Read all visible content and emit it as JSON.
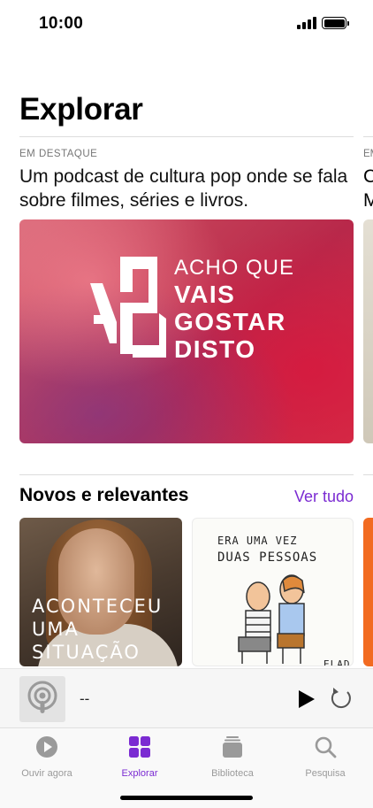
{
  "status": {
    "time": "10:00"
  },
  "page": {
    "title": "Explorar"
  },
  "featured": {
    "eyebrow": "EM DESTAQUE",
    "description": "Um podcast de cultura pop onde se fala sobre filmes, séries e livros.",
    "peek_eyebrow": "EM",
    "peek_desc_1": "C",
    "peek_desc_2": "M",
    "artwork": {
      "logo_text": "VG",
      "line1": "ACHO QUE",
      "line2": "VAIS",
      "line3": "GOSTAR",
      "line4": "DISTO"
    }
  },
  "new_section": {
    "title": "Novos e relevantes",
    "see_all": "Ver tudo",
    "tiles": [
      {
        "lines": [
          "ACONTECEU",
          "UMA",
          "SITUAÇÃO"
        ]
      },
      {
        "lines": [
          "ERA UMA VEZ",
          "DUAS PESSOAS"
        ],
        "corner": "ELAD"
      }
    ]
  },
  "mini_player": {
    "title": "--"
  },
  "tabs": [
    {
      "label": "Ouvir agora",
      "icon": "play-circle-icon",
      "active": false
    },
    {
      "label": "Explorar",
      "icon": "grid-icon",
      "active": true
    },
    {
      "label": "Biblioteca",
      "icon": "library-icon",
      "active": false
    },
    {
      "label": "Pesquisa",
      "icon": "search-icon",
      "active": false
    }
  ],
  "colors": {
    "accent": "#7b2bd2",
    "inactive_tab": "#9a9a9a"
  }
}
